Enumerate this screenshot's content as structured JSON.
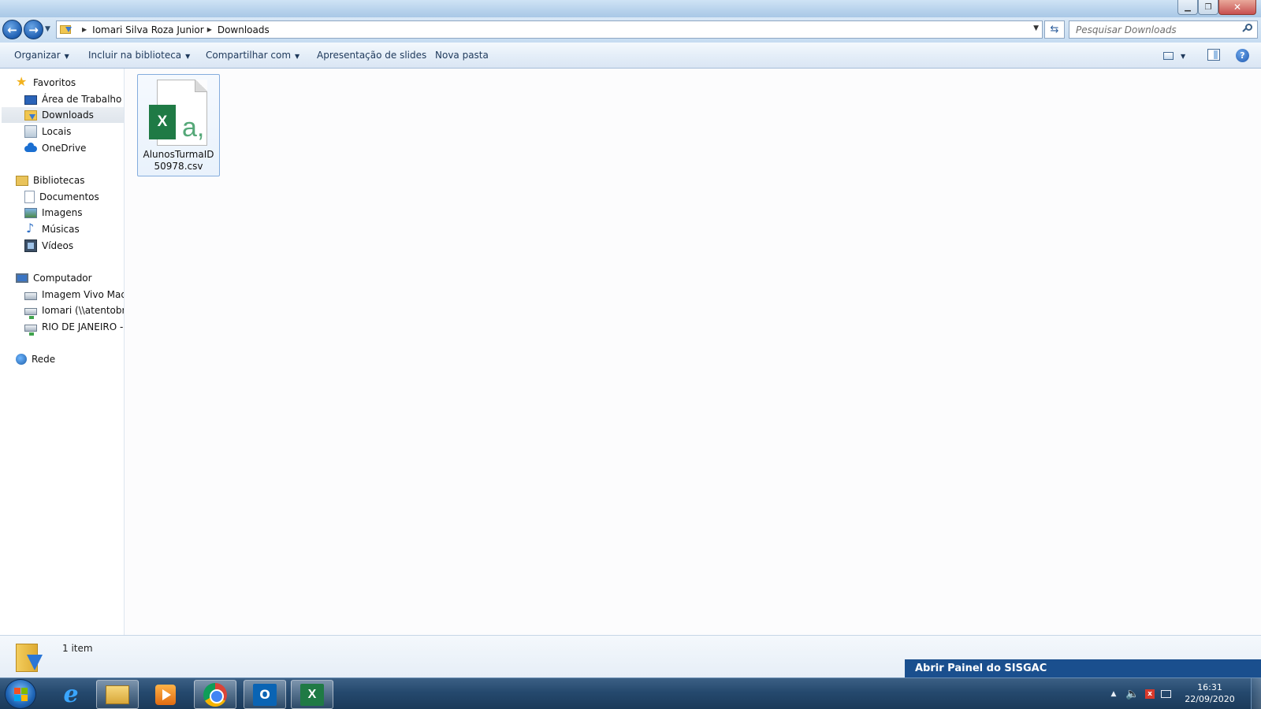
{
  "window": {
    "title": "",
    "close_glyph": "✕",
    "minimize_glyph": "▁",
    "maximize_glyph": "❐"
  },
  "address": {
    "crumbs": [
      "Iomari Silva Roza Junior",
      "Downloads"
    ],
    "search_placeholder": "Pesquisar Downloads"
  },
  "toolbar": {
    "organize": "Organizar",
    "include_library": "Incluir na biblioteca",
    "share_with": "Compartilhar com",
    "slideshow": "Apresentação de slides",
    "new_folder": "Nova pasta"
  },
  "sidebar": {
    "favorites": {
      "header": "Favoritos",
      "items": [
        "Área de Trabalho",
        "Downloads",
        "Locais",
        "OneDrive"
      ]
    },
    "libraries": {
      "header": "Bibliotecas",
      "items": [
        "Documentos",
        "Imagens",
        "Músicas",
        "Vídeos"
      ]
    },
    "computer": {
      "header": "Computador",
      "items": [
        "Imagem Vivo Mad (\\",
        "Iomari (\\\\atentobr\\c",
        "RIO DE JANEIRO - C/"
      ]
    },
    "network": {
      "header": "Rede"
    },
    "selected_item": "Downloads"
  },
  "files": [
    {
      "name": "AlunosTurmaID50978.csv",
      "icon": "excel-csv-file-icon"
    }
  ],
  "status": {
    "item_count": "1 item",
    "banner": "Abrir Painel do SISGAC"
  },
  "taskbar": {
    "apps": [
      "internet-explorer",
      "windows-explorer",
      "media-player",
      "chrome",
      "outlook",
      "excel"
    ],
    "clock_time": "16:31",
    "clock_date": "22/09/2020"
  }
}
